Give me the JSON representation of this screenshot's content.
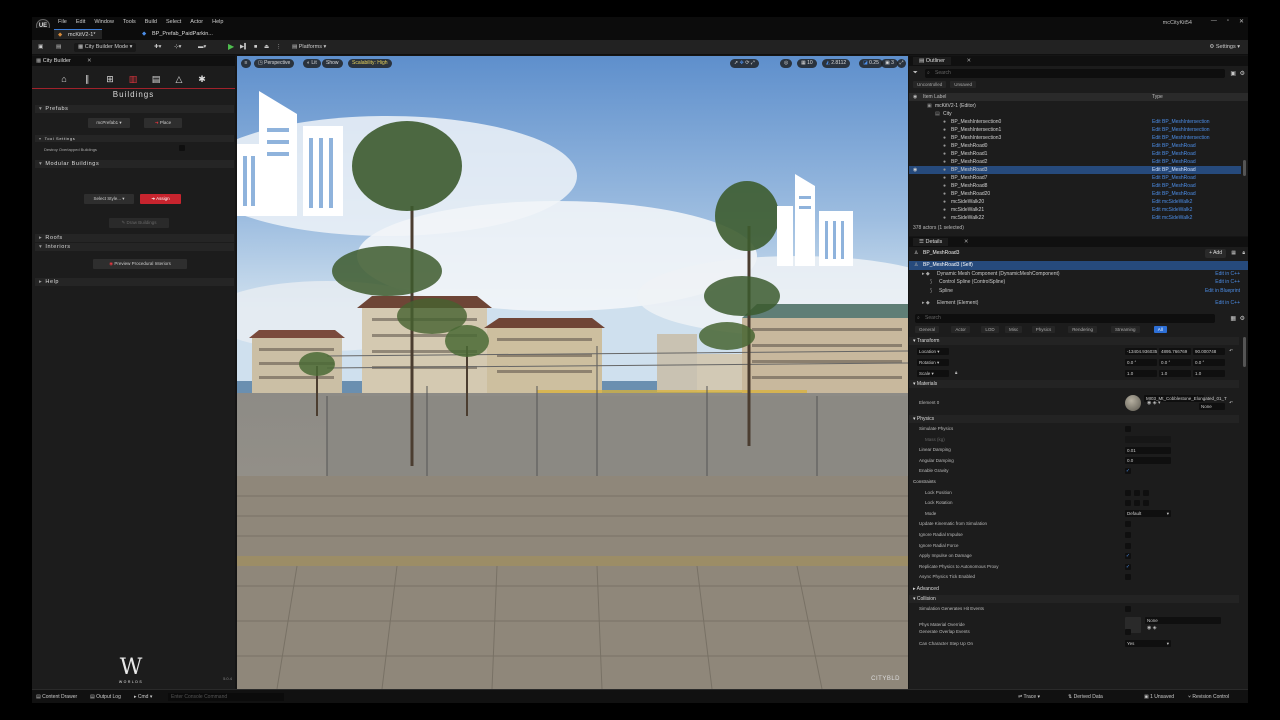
{
  "app": {
    "logo": "UE",
    "menu": [
      "File",
      "Edit",
      "Window",
      "Tools",
      "Build",
      "Select",
      "Actor",
      "Help"
    ],
    "window_title": "mcCityKit54",
    "window_controls": [
      "—",
      "▫",
      "✕"
    ]
  },
  "doc_tabs": [
    {
      "label": "mcKitV2-1*",
      "active": true
    },
    {
      "label": "BP_Prefab_PaidParkin...",
      "active": false
    }
  ],
  "toolbar": {
    "mode": "City Builder Mode",
    "platforms": "Platforms",
    "settings": "Settings"
  },
  "left_panel": {
    "tab": "City Builder",
    "section_title": "Buildings",
    "prefabs": {
      "header": "Prefabs",
      "dropdown": "mcPrefab1",
      "place": "Place",
      "tool_settings": "Tool Settings",
      "destroy_overlapped": "Destroy Overlapped Buildings"
    },
    "modular": {
      "header": "Modular Buildings",
      "select_style": "Select Style...",
      "assign": "Assign",
      "draw": "Draw Buildings"
    },
    "roofs": "Roofs",
    "interiors": "Interiors",
    "preview_interiors": "Preview Procedural Interiors",
    "help": "Help",
    "brand_word": "WORLDS",
    "version": "5.0.4"
  },
  "viewport": {
    "perspective": "Perspective",
    "lit": "Lit",
    "show": "Show",
    "scalability": "Scalability: High",
    "grid_snap": "10",
    "rot_snap": "10°",
    "scale_snap": "0.25",
    "speed": "3",
    "fov": "2.8112",
    "watermark": "CITYBLD"
  },
  "outliner": {
    "tab": "Outliner",
    "search_placeholder": "Search",
    "filters": [
      "Uncontrolled",
      "Unsaved"
    ],
    "col_label": "Item Label",
    "col_type": "Type",
    "rows": [
      {
        "label": "mcKitV2-1 (Editor)",
        "type": "",
        "indent": 2,
        "icon": "▣"
      },
      {
        "label": "City",
        "type": "",
        "indent": 3,
        "icon": "▤"
      },
      {
        "label": "BP_MeshIntersection0",
        "type": "Edit BP_MeshIntersection",
        "indent": 4,
        "icon": "●"
      },
      {
        "label": "BP_MeshIntersection1",
        "type": "Edit BP_MeshIntersection",
        "indent": 4,
        "icon": "●"
      },
      {
        "label": "BP_MeshIntersection3",
        "type": "Edit BP_MeshIntersection",
        "indent": 4,
        "icon": "●"
      },
      {
        "label": "BP_MeshRoad0",
        "type": "Edit BP_MeshRoad",
        "indent": 4,
        "icon": "●"
      },
      {
        "label": "BP_MeshRoad1",
        "type": "Edit BP_MeshRoad",
        "indent": 4,
        "icon": "●"
      },
      {
        "label": "BP_MeshRoad2",
        "type": "Edit BP_MeshRoad",
        "indent": 4,
        "icon": "●"
      },
      {
        "label": "BP_MeshRoad3",
        "type": "Edit BP_MeshRoad",
        "indent": 4,
        "icon": "●",
        "selected": true
      },
      {
        "label": "BP_MeshRoad7",
        "type": "Edit BP_MeshRoad",
        "indent": 4,
        "icon": "●"
      },
      {
        "label": "BP_MeshRoad8",
        "type": "Edit BP_MeshRoad",
        "indent": 4,
        "icon": "●"
      },
      {
        "label": "BP_MeshRoad20",
        "type": "Edit BP_MeshRoad",
        "indent": 4,
        "icon": "●"
      },
      {
        "label": "mcSideWalk20",
        "type": "Edit mcSideWalk2",
        "indent": 4,
        "icon": "●"
      },
      {
        "label": "mcSideWalk21",
        "type": "Edit mcSideWalk2",
        "indent": 4,
        "icon": "●"
      },
      {
        "label": "mcSideWalk22",
        "type": "Edit mcSideWalk2",
        "indent": 4,
        "icon": "●"
      }
    ],
    "status": "378 actors (1 selected)"
  },
  "details": {
    "tab": "Details",
    "actor_name": "BP_MeshRoad3",
    "add_label": "+ Add",
    "components": [
      {
        "label": "BP_MeshRoad3 (Self)",
        "right": "",
        "indent": 0,
        "selected": true
      },
      {
        "label": "Dynamic Mesh Component (DynamicMeshComponent)",
        "right": "Edit in C++",
        "indent": 1
      },
      {
        "label": "Control Spline (ControlSpline)",
        "right": "Edit in C++",
        "indent": 2
      },
      {
        "label": "Spline",
        "right": "Edit in Blueprint",
        "indent": 2
      },
      {
        "label": "Element (Element)",
        "right": "Edit in C++",
        "indent": 1
      }
    ],
    "search_placeholder": "Search",
    "categories": [
      "General",
      "Actor",
      "LOD",
      "Misc",
      "Physics",
      "Rendering",
      "Streaming",
      "All"
    ],
    "transform": {
      "header": "Transform",
      "location_label": "Location",
      "location": [
        "-13404.936035",
        "4895.766769",
        "90.000748"
      ],
      "rotation_label": "Rotation",
      "rotation": [
        "0.0 °",
        "0.0 °",
        "0.0 °"
      ],
      "scale_label": "Scale",
      "scale": [
        "1.0",
        "1.0",
        "1.0"
      ]
    },
    "materials": {
      "header": "Materials",
      "element": "Element 0",
      "material_name": "MI03_Mt_Cobblestone_Elongated_01_T",
      "none": "None"
    },
    "physics": {
      "header": "Physics",
      "rows": [
        {
          "label": "Simulate Physics",
          "kind": "check",
          "value": ""
        },
        {
          "label": "Mass (kg)",
          "kind": "dim",
          "value": ""
        },
        {
          "label": "Linear Damping",
          "kind": "field",
          "value": "0.01"
        },
        {
          "label": "Angular Damping",
          "kind": "field",
          "value": "0.0"
        },
        {
          "label": "Enable Gravity",
          "kind": "check",
          "value": "✓"
        },
        {
          "label": "Constraints",
          "kind": "sub",
          "value": ""
        },
        {
          "label": "Lock Position",
          "kind": "xyz",
          "value": ""
        },
        {
          "label": "Lock Rotation",
          "kind": "xyz",
          "value": ""
        },
        {
          "label": "Mode",
          "kind": "select",
          "value": "Default"
        },
        {
          "label": "Update Kinematic from Simulation",
          "kind": "check",
          "value": ""
        },
        {
          "label": "Ignore Radial Impulse",
          "kind": "check",
          "value": ""
        },
        {
          "label": "Ignore Radial Force",
          "kind": "check",
          "value": ""
        },
        {
          "label": "Apply Impulse on Damage",
          "kind": "check",
          "value": "✓"
        },
        {
          "label": "Replicate Physics to Autonomous Proxy",
          "kind": "check",
          "value": "✓"
        },
        {
          "label": "Async Physics Tick Enabled",
          "kind": "check",
          "value": ""
        }
      ],
      "advanced": "Advanced"
    },
    "collision": {
      "header": "Collision",
      "rows": [
        {
          "label": "Simulation Generates Hit Events",
          "kind": "check",
          "value": ""
        },
        {
          "label": "Phys Material Override",
          "kind": "asset",
          "value": "None"
        },
        {
          "label": "Generate Overlap Events",
          "kind": "check",
          "value": ""
        },
        {
          "label": "Can Character Step Up On",
          "kind": "select",
          "value": "Yes"
        }
      ]
    }
  },
  "statusbar": {
    "content_drawer": "Content Drawer",
    "output_log": "Output Log",
    "cmd": "Cmd",
    "cmd_placeholder": "Enter Console Command",
    "trace": "Trace",
    "derived_data": "Derived Data",
    "unsaved": "1 Unsaved",
    "revision": "Revision Control"
  },
  "colors": {
    "accent_red": "#c7242e",
    "selection_blue": "#264a7c",
    "link_blue": "#4c8ee8",
    "panel_bg": "#1c1c1c"
  }
}
